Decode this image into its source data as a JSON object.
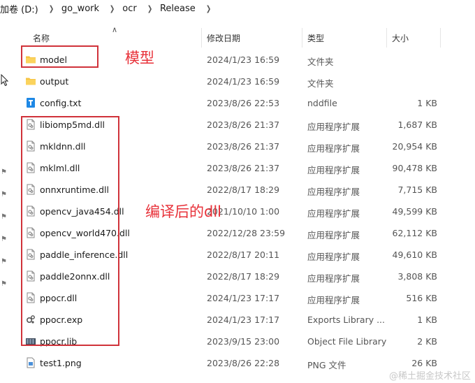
{
  "breadcrumb": [
    "加卷 (D:)",
    "go_work",
    "ocr",
    "Release"
  ],
  "columns": {
    "name": "名称",
    "date": "修改日期",
    "type": "类型",
    "size": "大小"
  },
  "files": [
    {
      "name": "model",
      "date": "2024/1/23 16:59",
      "type": "文件夹",
      "size": "",
      "icon": "folder-icon"
    },
    {
      "name": "output",
      "date": "2024/1/23 16:59",
      "type": "文件夹",
      "size": "",
      "icon": "folder-icon"
    },
    {
      "name": "config.txt",
      "date": "2023/8/26 22:53",
      "type": "nddfile",
      "size": "1 KB",
      "icon": "text-file-icon"
    },
    {
      "name": "libiomp5md.dll",
      "date": "2023/8/26 21:37",
      "type": "应用程序扩展",
      "size": "1,687 KB",
      "icon": "dll-file-icon"
    },
    {
      "name": "mkldnn.dll",
      "date": "2023/8/26 21:37",
      "type": "应用程序扩展",
      "size": "20,954 KB",
      "icon": "dll-file-icon"
    },
    {
      "name": "mklml.dll",
      "date": "2023/8/26 21:37",
      "type": "应用程序扩展",
      "size": "90,478 KB",
      "icon": "dll-file-icon"
    },
    {
      "name": "onnxruntime.dll",
      "date": "2022/8/17 18:29",
      "type": "应用程序扩展",
      "size": "7,715 KB",
      "icon": "dll-file-icon"
    },
    {
      "name": "opencv_java454.dll",
      "date": "2021/10/10 1:00",
      "type": "应用程序扩展",
      "size": "49,599 KB",
      "icon": "dll-file-icon"
    },
    {
      "name": "opencv_world470.dll",
      "date": "2022/12/28 23:59",
      "type": "应用程序扩展",
      "size": "62,112 KB",
      "icon": "dll-file-icon"
    },
    {
      "name": "paddle_inference.dll",
      "date": "2022/8/17 20:11",
      "type": "应用程序扩展",
      "size": "49,610 KB",
      "icon": "dll-file-icon"
    },
    {
      "name": "paddle2onnx.dll",
      "date": "2022/8/17 18:29",
      "type": "应用程序扩展",
      "size": "3,808 KB",
      "icon": "dll-file-icon"
    },
    {
      "name": "ppocr.dll",
      "date": "2024/1/23 17:17",
      "type": "应用程序扩展",
      "size": "516 KB",
      "icon": "dll-file-icon"
    },
    {
      "name": "ppocr.exp",
      "date": "2024/1/23 17:17",
      "type": "Exports Library ...",
      "size": "1 KB",
      "icon": "exp-file-icon"
    },
    {
      "name": "ppocr.lib",
      "date": "2023/9/15 23:00",
      "type": "Object File Library",
      "size": "2 KB",
      "icon": "lib-file-icon"
    },
    {
      "name": "test1.png",
      "date": "2023/8/26 22:28",
      "type": "PNG 文件",
      "size": "26 KB",
      "icon": "png-file-icon"
    }
  ],
  "annotations": {
    "model_label": "模型",
    "dll_label": "编译后的dll"
  },
  "watermark": "@稀土掘金技术社区",
  "colors": {
    "annotation_red": "#e8323a",
    "folder_yellow": "#f6c342",
    "text_file_blue": "#1e88e5"
  }
}
